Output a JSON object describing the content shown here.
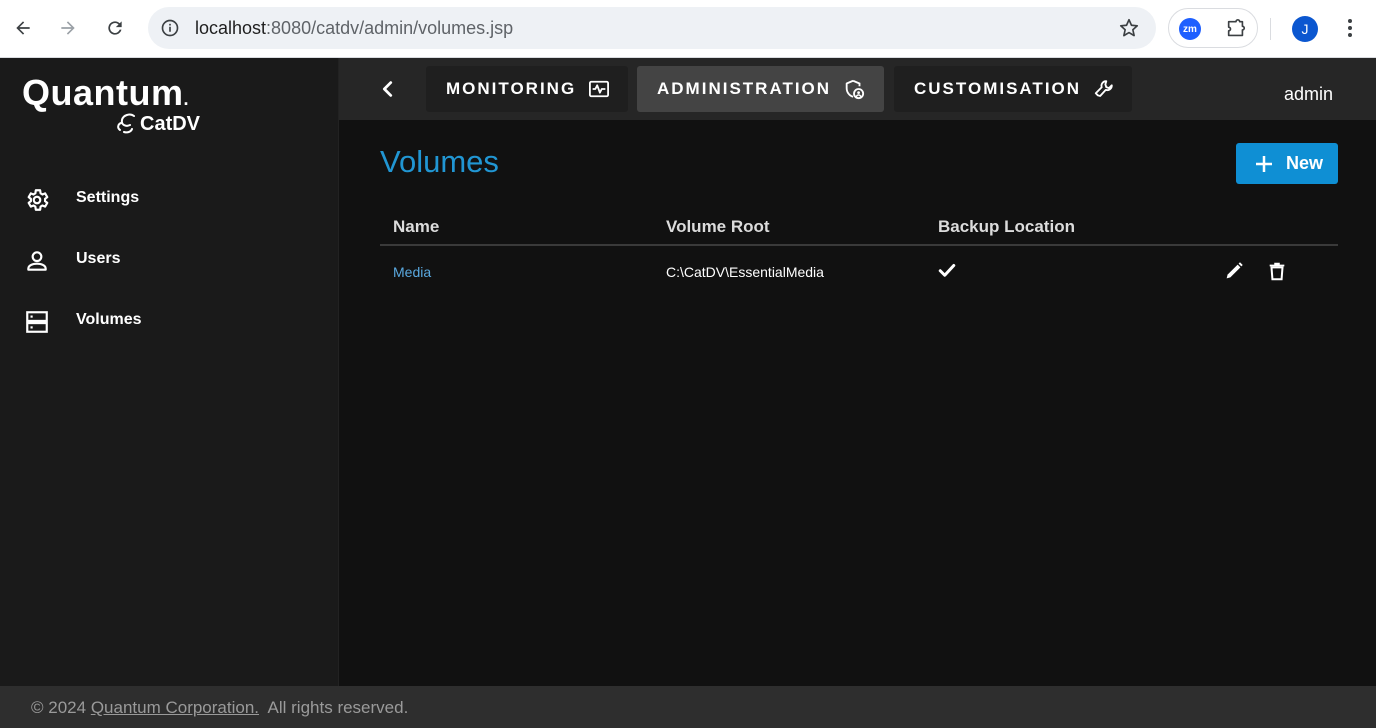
{
  "browser": {
    "url_host": "localhost",
    "url_path": ":8080/catdv/admin/volumes.jsp",
    "extension_label": "zm",
    "profile_initial": "J"
  },
  "sidebar": {
    "logo_main": "Quantum",
    "logo_mark": ".",
    "logo_sub": "CatDV",
    "items": [
      {
        "label": "Settings",
        "icon": "gear-icon"
      },
      {
        "label": "Users",
        "icon": "user-icon"
      },
      {
        "label": "Volumes",
        "icon": "storage-icon"
      }
    ]
  },
  "topnav": {
    "tabs": [
      {
        "label": "MONITORING",
        "icon": "monitoring-icon"
      },
      {
        "label": "ADMINISTRATION",
        "icon": "admin-icon"
      },
      {
        "label": "CUSTOMISATION",
        "icon": "wrench-icon"
      }
    ],
    "active_tab": "ADMINISTRATION",
    "user": "admin"
  },
  "main": {
    "title": "Volumes",
    "new_label": "New",
    "columns": [
      "Name",
      "Volume Root",
      "Backup Location"
    ],
    "rows": [
      {
        "name": "Media",
        "root": "C:\\CatDV\\EssentialMedia",
        "backup": true
      }
    ]
  },
  "footer": {
    "copyright": "© 2024",
    "company": "Quantum Corporation.",
    "rights": "All rights reserved."
  },
  "colors": {
    "accent": "#2196d3",
    "button": "#0f8fd4",
    "link": "#5aa9e0",
    "background": "#111111"
  }
}
